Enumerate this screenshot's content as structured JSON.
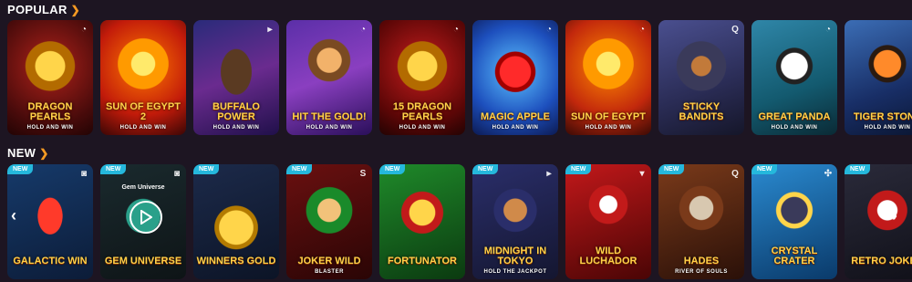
{
  "sections": {
    "popular": {
      "title": "POPULAR"
    },
    "new": {
      "title": "NEW"
    }
  },
  "colors": {
    "background": "#1d1522",
    "accent": "#f59a23",
    "new_badge": "#25b8dc"
  },
  "popular": [
    {
      "name": "DRAGON PEARLS",
      "sub": "HOLD AND WIN",
      "provider_icon": "booongo-icon"
    },
    {
      "name": "SUN OF EGYPT 2",
      "sub": "HOLD AND WIN",
      "provider_icon": ""
    },
    {
      "name": "BUFFALO POWER",
      "sub": "HOLD AND WIN",
      "provider_icon": "playson-icon"
    },
    {
      "name": "HIT THE GOLD!",
      "sub": "HOLD AND WIN",
      "provider_icon": "booongo-icon"
    },
    {
      "name": "15 DRAGON PEARLS",
      "sub": "HOLD AND WIN",
      "provider_icon": "booongo-icon"
    },
    {
      "name": "MAGIC APPLE",
      "sub": "HOLD AND WIN",
      "provider_icon": "booongo-icon"
    },
    {
      "name": "SUN OF EGYPT",
      "sub": "HOLD AND WIN",
      "provider_icon": "booongo-icon"
    },
    {
      "name": "STICKY BANDITS",
      "sub": "",
      "provider_icon": "quickspin-icon"
    },
    {
      "name": "GREAT PANDA",
      "sub": "HOLD AND WIN",
      "provider_icon": "booongo-icon"
    },
    {
      "name": "TIGER STONE",
      "sub": "HOLD AND WIN",
      "provider_icon": "booongo-icon"
    }
  ],
  "new": [
    {
      "badge": "NEW",
      "name": "GALACTIC WIN",
      "sub": "",
      "provider_icon": "bgaming-icon"
    },
    {
      "badge": "NEW",
      "name": "GEM UNIVERSE",
      "sub": "",
      "provider_icon": "bgaming-icon",
      "hover_title": "Gem Universe"
    },
    {
      "badge": "NEW",
      "name": "WINNERS GOLD",
      "sub": "",
      "provider_icon": ""
    },
    {
      "badge": "NEW",
      "name": "JOKER WILD",
      "sub": "BLASTER",
      "provider_icon": "spinomenal-icon"
    },
    {
      "badge": "NEW",
      "name": "FORTUNATOR",
      "sub": "",
      "provider_icon": ""
    },
    {
      "badge": "NEW",
      "name": "MIDNIGHT IN TOKYO",
      "sub": "HOLD THE JACKPOT",
      "provider_icon": "playson-icon"
    },
    {
      "badge": "NEW",
      "name": "WILD LUCHADOR",
      "sub": "",
      "provider_icon": "triangle-icon"
    },
    {
      "badge": "NEW",
      "name": "HADES",
      "sub": "RIVER OF SOULS",
      "provider_icon": "quickspin-icon"
    },
    {
      "badge": "NEW",
      "name": "CRYSTAL CRATER",
      "sub": "",
      "provider_icon": "dice-icon"
    },
    {
      "badge": "NEW",
      "name": "RETRO JOKER",
      "sub": "",
      "provider_icon": ""
    }
  ],
  "nav": {
    "left": "‹",
    "right": "›"
  }
}
